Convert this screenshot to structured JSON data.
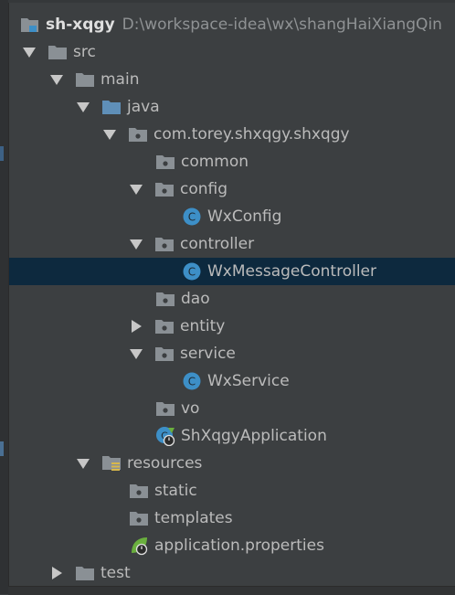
{
  "project": {
    "name": "sh-xqgy",
    "path": "D:\\workspace-idea\\wx\\shangHaiXiangQin"
  },
  "tree": {
    "src": "src",
    "main": "main",
    "java": "java",
    "package": "com.torey.shxqgy.shxqgy",
    "common": "common",
    "config": "config",
    "wx_config": "WxConfig",
    "controller": "controller",
    "wx_message_controller": "WxMessageController",
    "dao": "dao",
    "entity": "entity",
    "service": "service",
    "wx_service": "WxService",
    "vo": "vo",
    "application_class": "ShXqgyApplication",
    "resources": "resources",
    "static": "static",
    "templates": "templates",
    "application_properties": "application.properties",
    "test": "test"
  },
  "icons": {
    "class_letter": "C"
  },
  "colors": {
    "background": "#3c3f41",
    "selection": "#0d293e",
    "text": "#bbbbbb",
    "folder": "#8a9095",
    "source_folder": "#5f8fb8",
    "class_icon": "#3d8fc7",
    "spring_green": "#6aaf3e"
  }
}
